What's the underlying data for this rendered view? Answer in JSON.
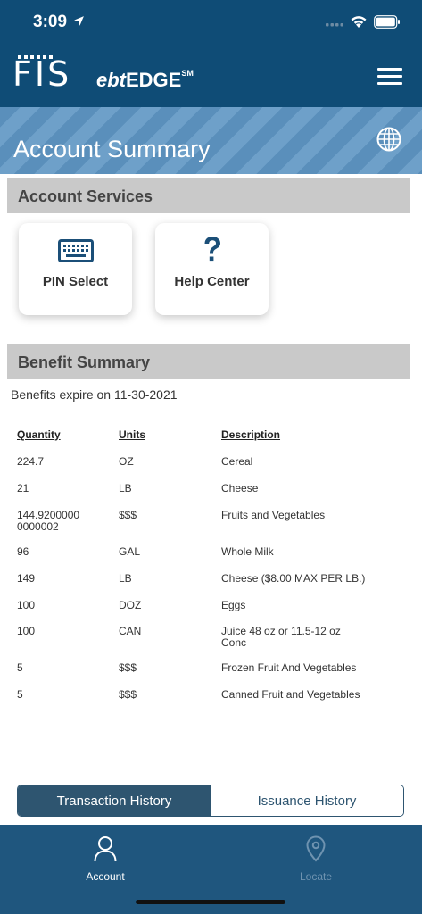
{
  "status_bar": {
    "time": "3:09"
  },
  "header": {
    "logo_fis": "FIS",
    "logo_ebt": "ebt",
    "logo_edge": "EDGE",
    "logo_sm": "SM"
  },
  "page_title": "Account Summary",
  "account_services": {
    "title": "Account Services",
    "cards": [
      {
        "label": "PIN Select",
        "icon": "keyboard-icon"
      },
      {
        "label": "Help Center",
        "icon": "question-icon"
      }
    ]
  },
  "benefit_summary": {
    "title": "Benefit Summary",
    "expire_text": "Benefits expire on 11-30-2021",
    "columns": [
      "Quantity",
      "Units",
      "Description"
    ],
    "rows": [
      {
        "quantity": "224.7",
        "units": "OZ",
        "description": "Cereal"
      },
      {
        "quantity": "21",
        "units": "LB",
        "description": "Cheese"
      },
      {
        "quantity": "144.9200000\n0000002",
        "units": "$$$",
        "description": "Fruits and Vegetables"
      },
      {
        "quantity": "96",
        "units": "GAL",
        "description": "Whole Milk"
      },
      {
        "quantity": "149",
        "units": "LB",
        "description": "Cheese ($8.00 MAX PER LB.)"
      },
      {
        "quantity": "100",
        "units": "DOZ",
        "description": "Eggs"
      },
      {
        "quantity": "100",
        "units": "CAN",
        "description": "Juice 48 oz or 11.5-12 oz\nConc"
      },
      {
        "quantity": "5",
        "units": "$$$",
        "description": "Frozen Fruit And Vegetables"
      },
      {
        "quantity": "5",
        "units": "$$$",
        "description": "Canned Fruit and Vegetables"
      }
    ]
  },
  "history_tabs": {
    "transaction": "Transaction History",
    "issuance": "Issuance History",
    "selected": "Transaction History"
  },
  "tab_bar": {
    "account": "Account",
    "locate": "Locate",
    "selected": "Account"
  },
  "colors": {
    "header": "#0f4c76",
    "banner": "#6ea0c9",
    "section_header": "#c9c9c9",
    "icon_blue": "#1b4f78",
    "tabbar": "#1f567e"
  }
}
